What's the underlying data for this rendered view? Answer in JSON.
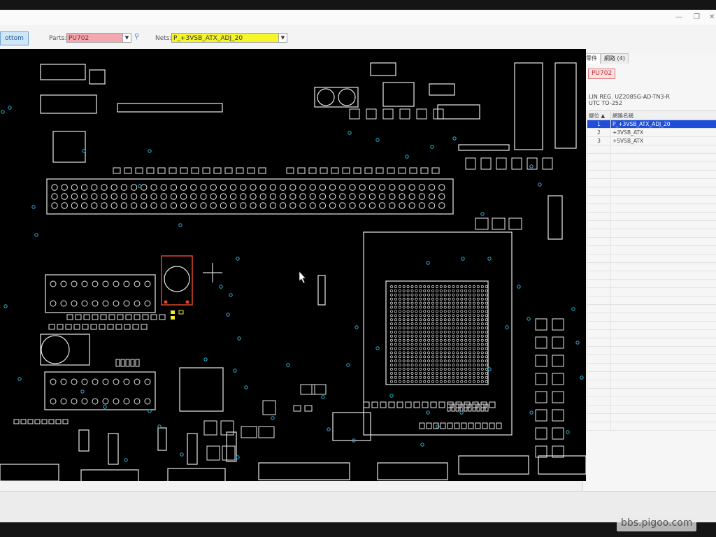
{
  "toolbar": {
    "side_button": "ottom",
    "parts_label": "Parts:",
    "parts_value": "PU702",
    "nets_label": "Nets:",
    "nets_value": "P_+3VSB_ATX_ADJ_20"
  },
  "side_panel": {
    "tabs": [
      {
        "label": "零件"
      },
      {
        "label": "網路 (4)"
      }
    ],
    "part_name": "PU702",
    "part_desc_line1": "LIN REG. UZ2085G-AD-TN3-R",
    "part_desc_line2": "UTC TO-252",
    "table_headers": {
      "col1": "腳位",
      "col2": "網路名稱"
    },
    "nets": [
      {
        "pin": "1",
        "net": "P_+3VSB_ATX_ADJ_20",
        "selected": true
      },
      {
        "pin": "2",
        "net": "+3VSB_ATX",
        "selected": false
      },
      {
        "pin": "3",
        "net": "+5VSB_ATX",
        "selected": false
      }
    ]
  },
  "watermark": "bbs.pigoo.com",
  "colors": {
    "canvas_bg": "#000000",
    "outline": "#e8e8e8",
    "highlight_part": "#e0462a",
    "highlight_net": "#f2ea2a",
    "via": "#2fb6d6",
    "selected_row": "#1f4fd8",
    "parts_field": "#f3a9b1",
    "nets_field": "#f5f52a"
  },
  "icons": {
    "parts_search": "magnifier-icon",
    "crosshair": "crosshair-cursor-icon",
    "pointer": "mouse-pointer-icon"
  }
}
